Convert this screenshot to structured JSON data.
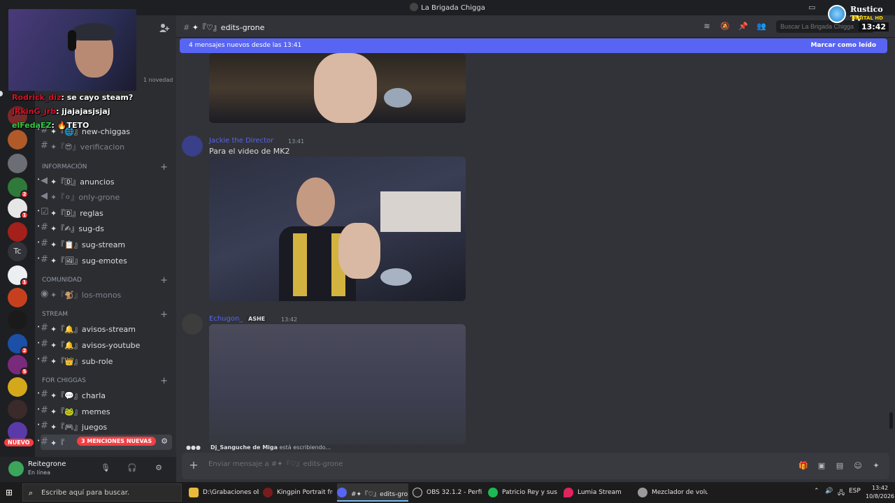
{
  "window": {
    "title": "La Brigada Chigga"
  },
  "guilds": {
    "badges": [
      "2",
      "1",
      "1",
      "2",
      "5"
    ],
    "tc_label": "Tc",
    "nuevo_label": "NUEVO"
  },
  "sidebar": {
    "novedad": "1 novedad",
    "categories": {
      "informacion": "INFORMACIÓN",
      "comunidad": "COMUNIDAD",
      "stream": "STREAM",
      "for_chiggas": "FOR CHIGGAS"
    },
    "channels": {
      "new_chiggas": "✦『🌐』new-chiggas",
      "verificacion": "✦『😎』verificacion",
      "anuncios": "✦『🄳』anuncios",
      "only_grone": "✦『⚪』only-grone",
      "reglas": "✦『🄳』reglas",
      "sug_ds": "✦『✍』sug-ds",
      "sug_stream": "✦『📋』sug-stream",
      "sug_emotes": "✦『🖼』sug-emotes",
      "los_monos": "✦『🐒』los-monos",
      "avisos_stream": "✦『🔔』avisos-stream",
      "avisos_youtube": "✦『🔔』avisos-youtube",
      "sub_role": "✦『👑』sub-role",
      "charla": "✦『💬』charla",
      "memes": "✦『🐸』memes",
      "juegos": "✦『🎮』juegos",
      "edits": "✦『"
    },
    "mentions": "3 MENCIONES NUEVAS"
  },
  "user": {
    "name": "Reitegrone",
    "status": "En línea"
  },
  "header": {
    "channel": "✦『♡』edits-grone",
    "search_placeholder": "Buscar La Brigada Chigga"
  },
  "new_messages": {
    "label": "4 mensajes nuevos desde las 13:41",
    "mark_read": "Marcar como leído"
  },
  "messages": [
    {
      "author": "Jackie the Director",
      "time": "13:41",
      "text": "Para el video de MK2"
    },
    {
      "author": "Echugon_",
      "tag": "ASHE",
      "time": "13:42"
    }
  ],
  "typing": {
    "user": "Dj_Sanguche de Miga",
    "text": "está escribiendo..."
  },
  "composer": {
    "placeholder": "Enviar mensaje a #✦『♡』edits-grone"
  },
  "stream_overlay": {
    "chat": [
      {
        "user": "Rodrick_diz",
        "text": ": se cayo steam?"
      },
      {
        "user": "JRkinG_jrb",
        "text": ": jjajajasjsjaj"
      },
      {
        "user": "elFedaEZ",
        "text": ": 🔥TETO"
      }
    ],
    "brand": "Rustico TV",
    "sub_brand": "DIGITAL HD",
    "clock": "13:42"
  },
  "taskbar": {
    "search_placeholder": "Escribe aquí para buscar.",
    "tasks": [
      "D:\\Grabaciones obs",
      "Kingpin Portrait fro...",
      "#✦『♡』edits-grone...",
      "OBS 32.1.2 - Perfil: ...",
      "Patricio Rey y sus R...",
      "Lumia Stream",
      "Mezclador de volu..."
    ],
    "language": "ESP",
    "time": "13:42",
    "date": "10/8/2026"
  },
  "colors": {
    "blurple": "#5865f2",
    "red": "#f23f43",
    "bg_main": "#313338",
    "bg_sidebar": "#2b2d31"
  }
}
